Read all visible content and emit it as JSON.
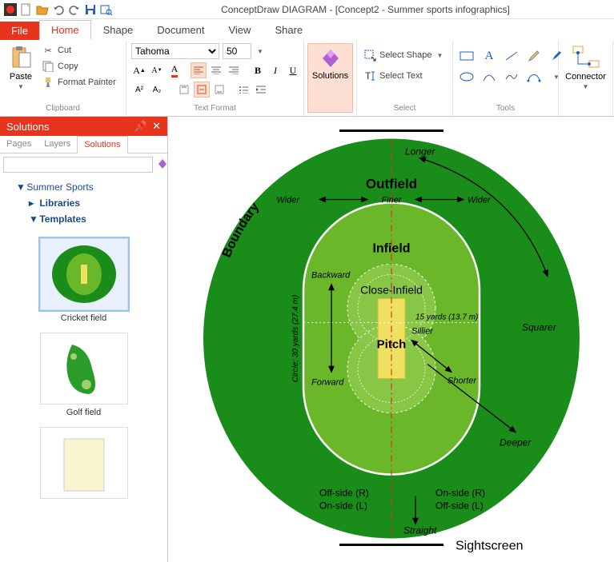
{
  "title": "ConceptDraw DIAGRAM - [Concept2 - Summer sports infographics]",
  "tabs": {
    "file": "File",
    "items": [
      "Home",
      "Shape",
      "Document",
      "View",
      "Share"
    ],
    "active": "Home"
  },
  "clipboard": {
    "paste": "Paste",
    "cut": "Cut",
    "copy": "Copy",
    "format_painter": "Format Painter",
    "label": "Clipboard"
  },
  "text_format": {
    "font": "Tahoma",
    "size": "50",
    "label": "Text Format"
  },
  "solutions_btn": "Solutions",
  "select": {
    "shape": "Select Shape",
    "text": "Select Text",
    "label": "Select"
  },
  "tools_label": "Tools",
  "connector": "Connector",
  "panel": {
    "title": "Solutions",
    "tabs": [
      "Pages",
      "Layers",
      "Solutions"
    ],
    "active": "Solutions",
    "tree": {
      "root": "Summer Sports",
      "libraries": "Libraries",
      "templates": "Templates"
    },
    "thumbs": [
      {
        "label": "Cricket field",
        "selected": true
      },
      {
        "label": "Golf field",
        "selected": false
      },
      {
        "label": "",
        "selected": false
      }
    ]
  },
  "diagram": {
    "boundary": "Boundary",
    "outfield": "Outfield",
    "infield": "Infield",
    "close_infield": "Close-Infield",
    "pitch": "Pitch",
    "longer": "Longer",
    "wider_l": "Wider",
    "wider_r": "Wider",
    "finer": "Finer",
    "backward": "Backward",
    "forward": "Forward",
    "sillier": "Sillier",
    "shorter": "Shorter",
    "squarer": "Squarer",
    "deeper": "Deeper",
    "straight": "Straight",
    "off_r": "Off-side (R)",
    "on_l": "On-side (L)",
    "on_r": "On-side (R)",
    "off_l": "Off-side (L)",
    "sightscreen": "Sightscreen",
    "circle_label": "Circle: 30 yards (27.4 m)",
    "yards15": "15 yards (13.7 m)"
  }
}
